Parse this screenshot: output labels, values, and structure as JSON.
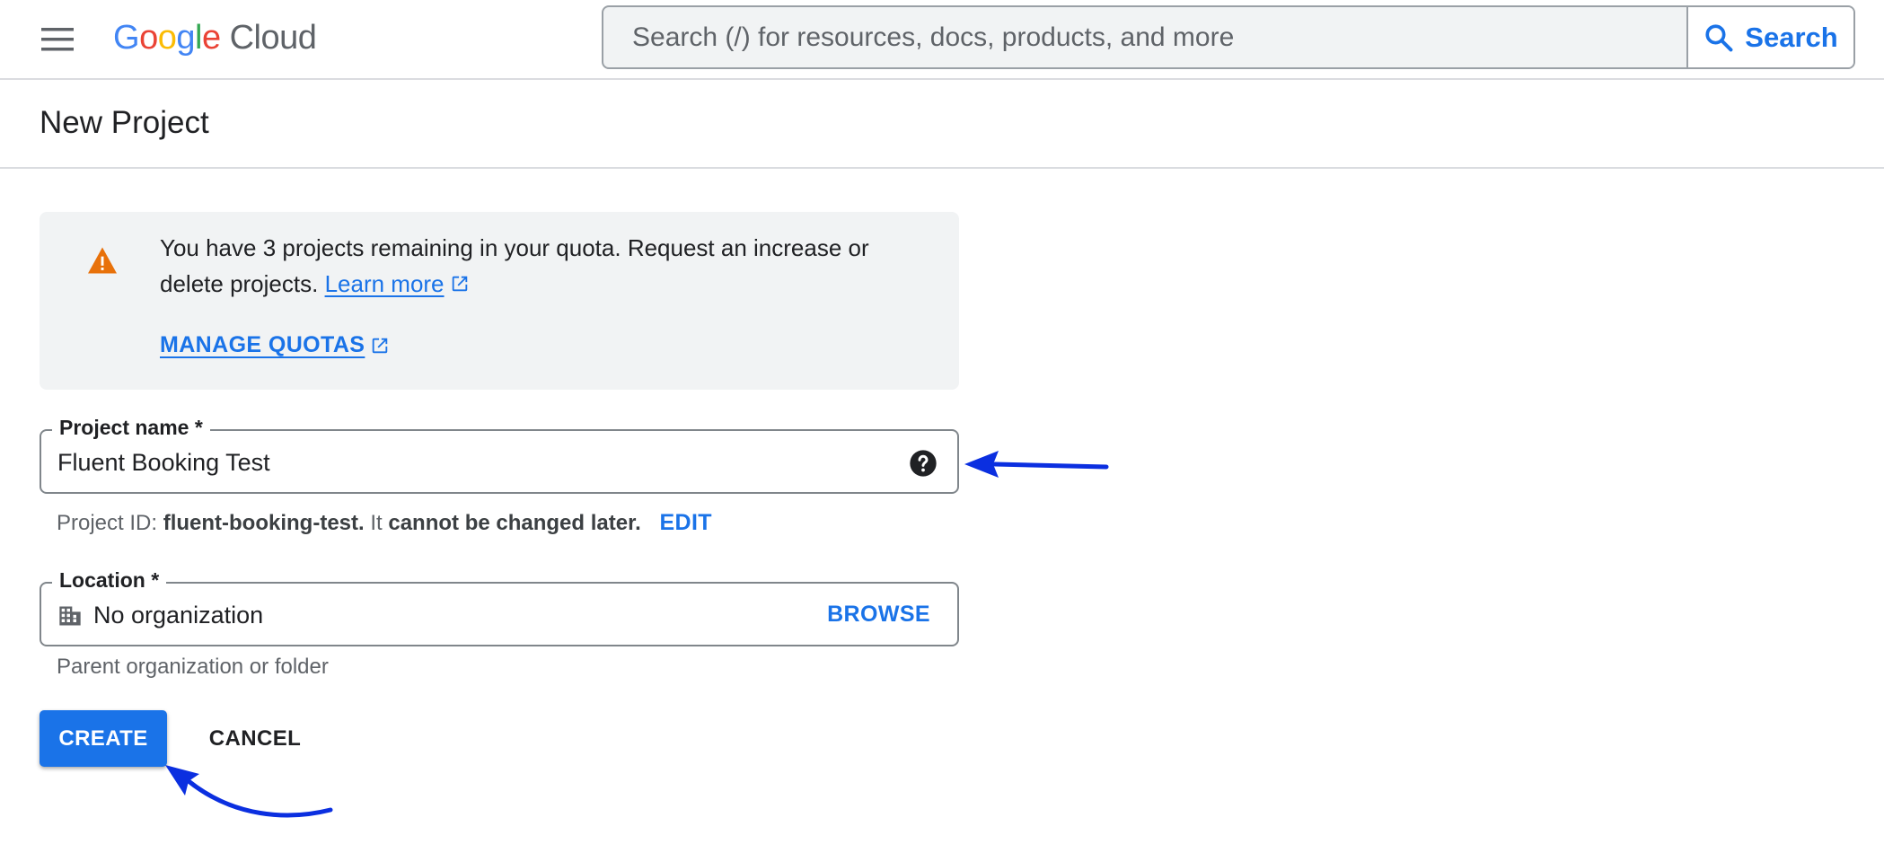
{
  "header": {
    "logo_google": [
      "G",
      "o",
      "o",
      "g",
      "l",
      "e"
    ],
    "logo_cloud": "Cloud",
    "search_placeholder": "Search (/) for resources, docs, products, and more",
    "search_button": "Search"
  },
  "page": {
    "title": "New Project"
  },
  "banner": {
    "text": "You have 3 projects remaining in your quota. Request an increase or delete projects.",
    "learn_more": "Learn more",
    "manage_quotas": "MANAGE QUOTAS"
  },
  "project_name": {
    "label": "Project name *",
    "value": "Fluent Booking Test"
  },
  "project_id": {
    "prefix": "Project ID:",
    "id": "fluent-booking-test.",
    "middle": "It",
    "warning": "cannot be changed later.",
    "edit": "EDIT"
  },
  "location": {
    "label": "Location *",
    "value": "No organization",
    "browse": "BROWSE",
    "hint": "Parent organization or folder"
  },
  "actions": {
    "create": "CREATE",
    "cancel": "CANCEL"
  },
  "colors": {
    "brand_blue": "#1a73e8",
    "warning_orange": "#e8710a",
    "annotation_arrow": "#0b2fe0"
  },
  "icons": [
    "menu-icon",
    "search-icon",
    "warning-icon",
    "external-link-icon",
    "help-icon",
    "organization-icon"
  ]
}
